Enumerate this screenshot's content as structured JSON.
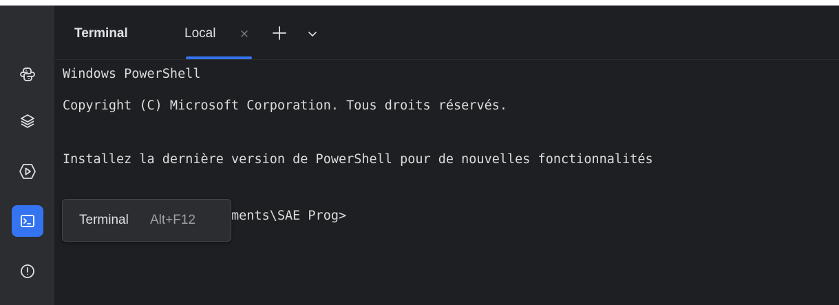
{
  "tool_window": {
    "title": "Terminal"
  },
  "tabs": [
    {
      "label": "Local",
      "active": true
    }
  ],
  "sidebar": {
    "items": [
      {
        "icon": "python-icon",
        "active": false
      },
      {
        "icon": "layers-icon",
        "active": false
      },
      {
        "icon": "run-icon",
        "active": false
      },
      {
        "icon": "terminal-icon",
        "active": true
      },
      {
        "icon": "problems-icon",
        "active": false
      }
    ]
  },
  "terminal": {
    "lines": [
      "Windows PowerShell",
      "Copyright (C) Microsoft Corporation. Tous droits réservés.",
      "",
      "Installez la dernière version de PowerShell pour de nouvelles fonctionnalités",
      "",
      "PS C:\\Users\\kevin\\Documents\\SAE Prog>"
    ]
  },
  "tooltip": {
    "title": "Terminal",
    "shortcut": "Alt+F12"
  },
  "colors": {
    "accent": "#3574f0",
    "background": "#1e1f22",
    "sidebar": "#2b2d30"
  }
}
